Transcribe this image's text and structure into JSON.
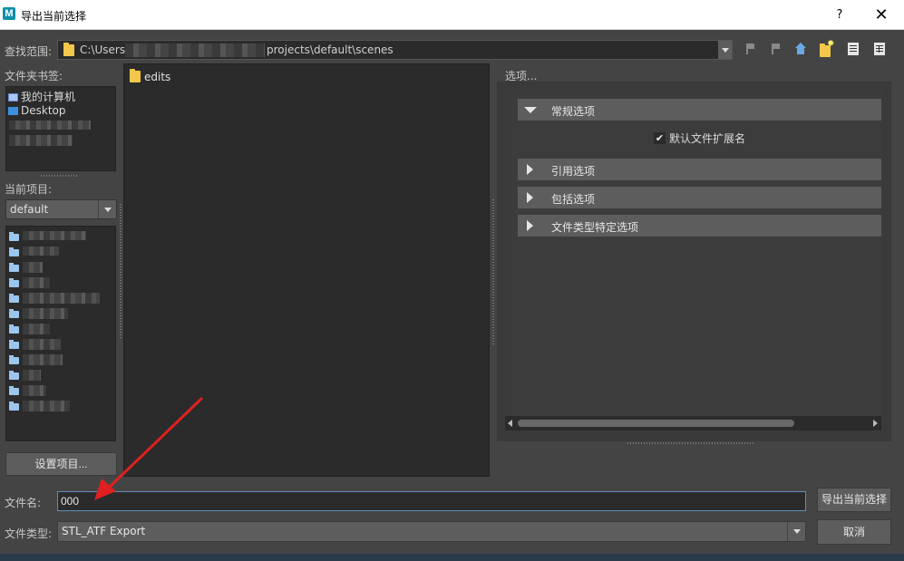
{
  "window": {
    "title": "导出当前选择",
    "app_icon": "M",
    "help_label": "?",
    "close_label": "✕"
  },
  "lookin": {
    "label": "查找范围:",
    "path_prefix": "C:\\Users",
    "path_suffix": "projects\\default\\scenes"
  },
  "bookmarks": {
    "label": "文件夹书签:",
    "items": [
      {
        "label": "我的计算机",
        "icon": "computer-icon"
      },
      {
        "label": "Desktop",
        "icon": "desktop-icon"
      }
    ]
  },
  "project": {
    "label": "当前项目:",
    "selected": "default",
    "set_button": "设置项目..."
  },
  "files": {
    "items": [
      {
        "label": "edits",
        "icon": "folder-icon"
      }
    ]
  },
  "options": {
    "label": "选项...",
    "sections": [
      {
        "label": "常规选项",
        "expanded": true
      },
      {
        "label": "引用选项",
        "expanded": false
      },
      {
        "label": "包括选项",
        "expanded": false
      },
      {
        "label": "文件类型特定选项",
        "expanded": false
      }
    ],
    "default_ext_label": "默认文件扩展名",
    "default_ext_checked": true
  },
  "filename": {
    "label": "文件名:",
    "value": "000"
  },
  "filetype": {
    "label": "文件类型:",
    "value": "STL_ATF Export"
  },
  "actions": {
    "export": "导出当前选择",
    "cancel": "取消"
  },
  "colors": {
    "annotation_arrow": "#e02020",
    "panel_bg": "#444444",
    "field_bg": "#2b2b2b",
    "accent_border": "#5f8fb8"
  }
}
